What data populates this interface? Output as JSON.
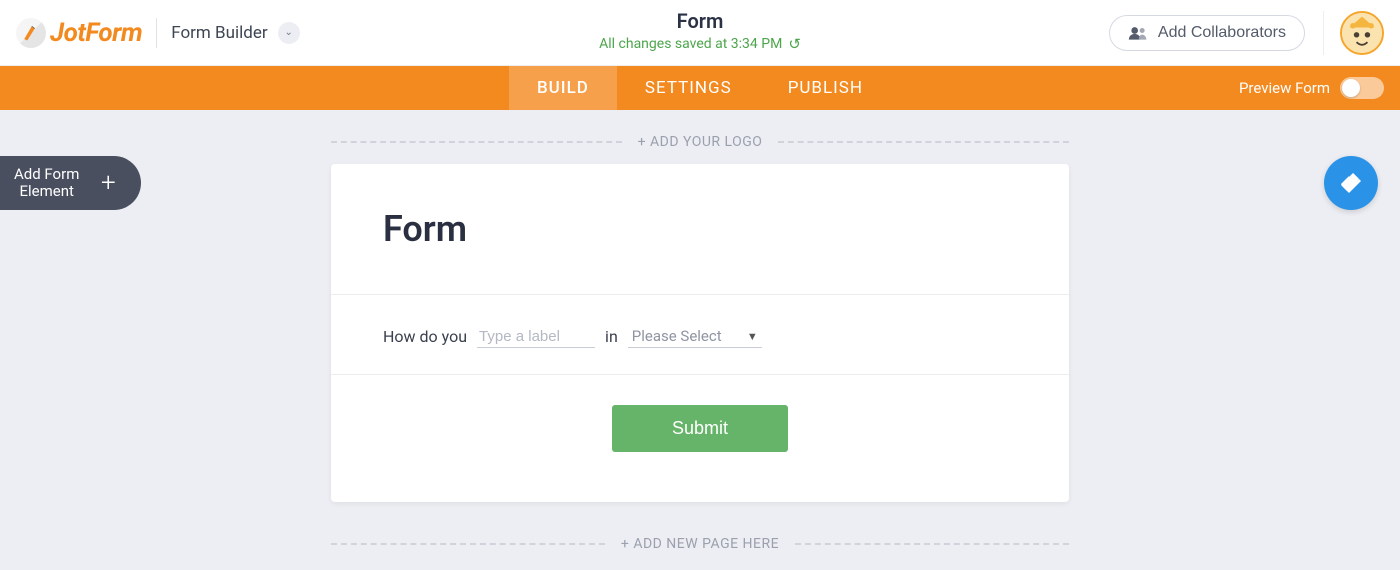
{
  "header": {
    "logo_text": "JotForm",
    "mode_label": "Form Builder",
    "form_title": "Form",
    "save_status": "All changes saved at 3:34 PM",
    "collab_label": "Add Collaborators"
  },
  "tabs": {
    "build": "BUILD",
    "settings": "SETTINGS",
    "publish": "PUBLISH",
    "preview_label": "Preview Form",
    "active": "build"
  },
  "side": {
    "add_element_line1": "Add Form",
    "add_element_line2": "Element"
  },
  "builder": {
    "logo_row": "+ ADD YOUR LOGO",
    "add_page_row": "+ ADD NEW PAGE HERE",
    "form_heading": "Form",
    "field": {
      "prefix": "How do you",
      "label_placeholder": "Type a label",
      "mid": "in",
      "select_placeholder": "Please Select"
    },
    "submit_label": "Submit"
  }
}
